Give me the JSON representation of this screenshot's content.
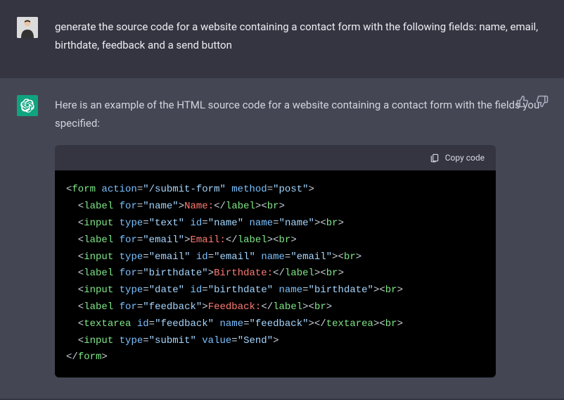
{
  "user": {
    "message": "generate the source code for a website containing a contact form with the following fields: name, email, birthdate, feedback and a send button"
  },
  "assistant": {
    "intro": "Here is an example of the HTML source code for a website containing a contact form with the fields you specified:"
  },
  "code_block": {
    "copy_label": "Copy code",
    "tokens": [
      [
        [
          "plain",
          "<"
        ],
        [
          "tag",
          "form"
        ],
        [
          "plain",
          " "
        ],
        [
          "attr",
          "action"
        ],
        [
          "plain",
          "="
        ],
        [
          "str",
          "\"/submit-form\""
        ],
        [
          "plain",
          " "
        ],
        [
          "attr",
          "method"
        ],
        [
          "plain",
          "="
        ],
        [
          "str",
          "\"post\""
        ],
        [
          "plain",
          ">"
        ]
      ],
      [
        [
          "plain",
          "  <"
        ],
        [
          "tag",
          "label"
        ],
        [
          "plain",
          " "
        ],
        [
          "attr",
          "for"
        ],
        [
          "plain",
          "="
        ],
        [
          "str",
          "\"name\""
        ],
        [
          "plain",
          ">"
        ],
        [
          "text",
          "Name:"
        ],
        [
          "plain",
          "</"
        ],
        [
          "tag",
          "label"
        ],
        [
          "plain",
          ">"
        ],
        [
          "plain",
          "<"
        ],
        [
          "tag",
          "br"
        ],
        [
          "plain",
          ">"
        ]
      ],
      [
        [
          "plain",
          "  <"
        ],
        [
          "tag",
          "input"
        ],
        [
          "plain",
          " "
        ],
        [
          "attr",
          "type"
        ],
        [
          "plain",
          "="
        ],
        [
          "str",
          "\"text\""
        ],
        [
          "plain",
          " "
        ],
        [
          "attr",
          "id"
        ],
        [
          "plain",
          "="
        ],
        [
          "str",
          "\"name\""
        ],
        [
          "plain",
          " "
        ],
        [
          "attr",
          "name"
        ],
        [
          "plain",
          "="
        ],
        [
          "str",
          "\"name\""
        ],
        [
          "plain",
          ">"
        ],
        [
          "plain",
          "<"
        ],
        [
          "tag",
          "br"
        ],
        [
          "plain",
          ">"
        ]
      ],
      [
        [
          "plain",
          "  <"
        ],
        [
          "tag",
          "label"
        ],
        [
          "plain",
          " "
        ],
        [
          "attr",
          "for"
        ],
        [
          "plain",
          "="
        ],
        [
          "str",
          "\"email\""
        ],
        [
          "plain",
          ">"
        ],
        [
          "text",
          "Email:"
        ],
        [
          "plain",
          "</"
        ],
        [
          "tag",
          "label"
        ],
        [
          "plain",
          ">"
        ],
        [
          "plain",
          "<"
        ],
        [
          "tag",
          "br"
        ],
        [
          "plain",
          ">"
        ]
      ],
      [
        [
          "plain",
          "  <"
        ],
        [
          "tag",
          "input"
        ],
        [
          "plain",
          " "
        ],
        [
          "attr",
          "type"
        ],
        [
          "plain",
          "="
        ],
        [
          "str",
          "\"email\""
        ],
        [
          "plain",
          " "
        ],
        [
          "attr",
          "id"
        ],
        [
          "plain",
          "="
        ],
        [
          "str",
          "\"email\""
        ],
        [
          "plain",
          " "
        ],
        [
          "attr",
          "name"
        ],
        [
          "plain",
          "="
        ],
        [
          "str",
          "\"email\""
        ],
        [
          "plain",
          ">"
        ],
        [
          "plain",
          "<"
        ],
        [
          "tag",
          "br"
        ],
        [
          "plain",
          ">"
        ]
      ],
      [
        [
          "plain",
          "  <"
        ],
        [
          "tag",
          "label"
        ],
        [
          "plain",
          " "
        ],
        [
          "attr",
          "for"
        ],
        [
          "plain",
          "="
        ],
        [
          "str",
          "\"birthdate\""
        ],
        [
          "plain",
          ">"
        ],
        [
          "text",
          "Birthdate:"
        ],
        [
          "plain",
          "</"
        ],
        [
          "tag",
          "label"
        ],
        [
          "plain",
          ">"
        ],
        [
          "plain",
          "<"
        ],
        [
          "tag",
          "br"
        ],
        [
          "plain",
          ">"
        ]
      ],
      [
        [
          "plain",
          "  <"
        ],
        [
          "tag",
          "input"
        ],
        [
          "plain",
          " "
        ],
        [
          "attr",
          "type"
        ],
        [
          "plain",
          "="
        ],
        [
          "str",
          "\"date\""
        ],
        [
          "plain",
          " "
        ],
        [
          "attr",
          "id"
        ],
        [
          "plain",
          "="
        ],
        [
          "str",
          "\"birthdate\""
        ],
        [
          "plain",
          " "
        ],
        [
          "attr",
          "name"
        ],
        [
          "plain",
          "="
        ],
        [
          "str",
          "\"birthdate\""
        ],
        [
          "plain",
          ">"
        ],
        [
          "plain",
          "<"
        ],
        [
          "tag",
          "br"
        ],
        [
          "plain",
          ">"
        ]
      ],
      [
        [
          "plain",
          "  <"
        ],
        [
          "tag",
          "label"
        ],
        [
          "plain",
          " "
        ],
        [
          "attr",
          "for"
        ],
        [
          "plain",
          "="
        ],
        [
          "str",
          "\"feedback\""
        ],
        [
          "plain",
          ">"
        ],
        [
          "text",
          "Feedback:"
        ],
        [
          "plain",
          "</"
        ],
        [
          "tag",
          "label"
        ],
        [
          "plain",
          ">"
        ],
        [
          "plain",
          "<"
        ],
        [
          "tag",
          "br"
        ],
        [
          "plain",
          ">"
        ]
      ],
      [
        [
          "plain",
          "  <"
        ],
        [
          "tag",
          "textarea"
        ],
        [
          "plain",
          " "
        ],
        [
          "attr",
          "id"
        ],
        [
          "plain",
          "="
        ],
        [
          "str",
          "\"feedback\""
        ],
        [
          "plain",
          " "
        ],
        [
          "attr",
          "name"
        ],
        [
          "plain",
          "="
        ],
        [
          "str",
          "\"feedback\""
        ],
        [
          "plain",
          ">"
        ],
        [
          "plain",
          "</"
        ],
        [
          "tag",
          "textarea"
        ],
        [
          "plain",
          ">"
        ],
        [
          "plain",
          "<"
        ],
        [
          "tag",
          "br"
        ],
        [
          "plain",
          ">"
        ]
      ],
      [
        [
          "plain",
          "  <"
        ],
        [
          "tag",
          "input"
        ],
        [
          "plain",
          " "
        ],
        [
          "attr",
          "type"
        ],
        [
          "plain",
          "="
        ],
        [
          "str",
          "\"submit\""
        ],
        [
          "plain",
          " "
        ],
        [
          "attr",
          "value"
        ],
        [
          "plain",
          "="
        ],
        [
          "str",
          "\"Send\""
        ],
        [
          "plain",
          ">"
        ]
      ],
      [
        [
          "plain",
          "</"
        ],
        [
          "tag",
          "form"
        ],
        [
          "plain",
          ">"
        ]
      ]
    ]
  }
}
